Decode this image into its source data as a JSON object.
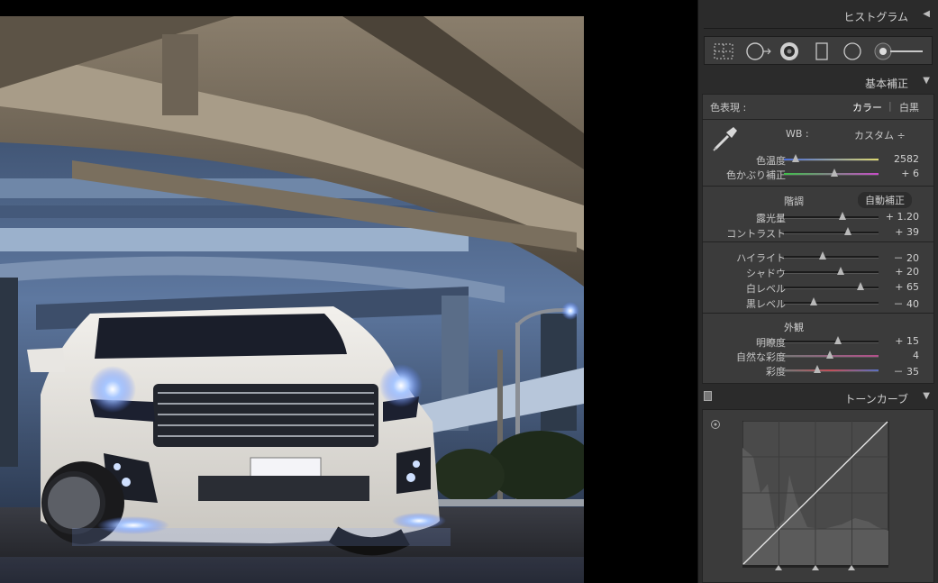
{
  "panel": {
    "histogram_title": "ヒストグラム",
    "basic_title": "基本補正",
    "tone_curve_title": "トーンカーブ",
    "collapse_icon": "triangle-left-icon",
    "expand_icon": "triangle-down-icon"
  },
  "tools": [
    "crop-overlay-icon",
    "spot-removal-icon",
    "red-eye-icon",
    "graduated-filter-icon",
    "radial-filter-icon",
    "adjustment-brush-icon"
  ],
  "treatment": {
    "label": "色表現 :",
    "color": "カラー",
    "sep": "|",
    "bw": "白黒"
  },
  "wb": {
    "label": "WB :",
    "value": "カスタム ÷"
  },
  "wb_sliders": [
    {
      "label": "色温度",
      "value": "2582",
      "pos": 0.12,
      "gradient": "linear-gradient(90deg,#4a6cd8,#ddd870)"
    },
    {
      "label": "色かぶり補正",
      "value": "+ 6",
      "pos": 0.53,
      "gradient": "linear-gradient(90deg,#3fc04b,#c84bc8)"
    }
  ],
  "tone": {
    "label": "階調",
    "auto": "自動補正",
    "sliders": [
      {
        "label": "露光量",
        "value": "+ 1.20",
        "pos": 0.62
      },
      {
        "label": "コントラスト",
        "value": "+ 39",
        "pos": 0.68
      }
    ]
  },
  "tone2": [
    {
      "label": "ハイライト",
      "value": "－ 20",
      "pos": 0.41
    },
    {
      "label": "シャドウ",
      "value": "+ 20",
      "pos": 0.6
    },
    {
      "label": "白レベル",
      "value": "+ 65",
      "pos": 0.81
    },
    {
      "label": "黒レベル",
      "value": "－ 40",
      "pos": 0.31
    }
  ],
  "presence": {
    "label": "外観",
    "sliders": [
      {
        "label": "明瞭度",
        "value": "+ 15",
        "pos": 0.57
      },
      {
        "label": "自然な彩度",
        "value": "4",
        "pos": 0.49,
        "gradient": "linear-gradient(90deg,#777,#b3508a)"
      },
      {
        "label": "彩度",
        "value": "－ 35",
        "pos": 0.35,
        "gradient": "linear-gradient(90deg,#777,#c0505a,#5a70c0)"
      }
    ]
  },
  "colors": {
    "panel_bg": "#2b2b2b",
    "section_bg": "#3b3b3b",
    "accent_text": "#ffffff"
  }
}
